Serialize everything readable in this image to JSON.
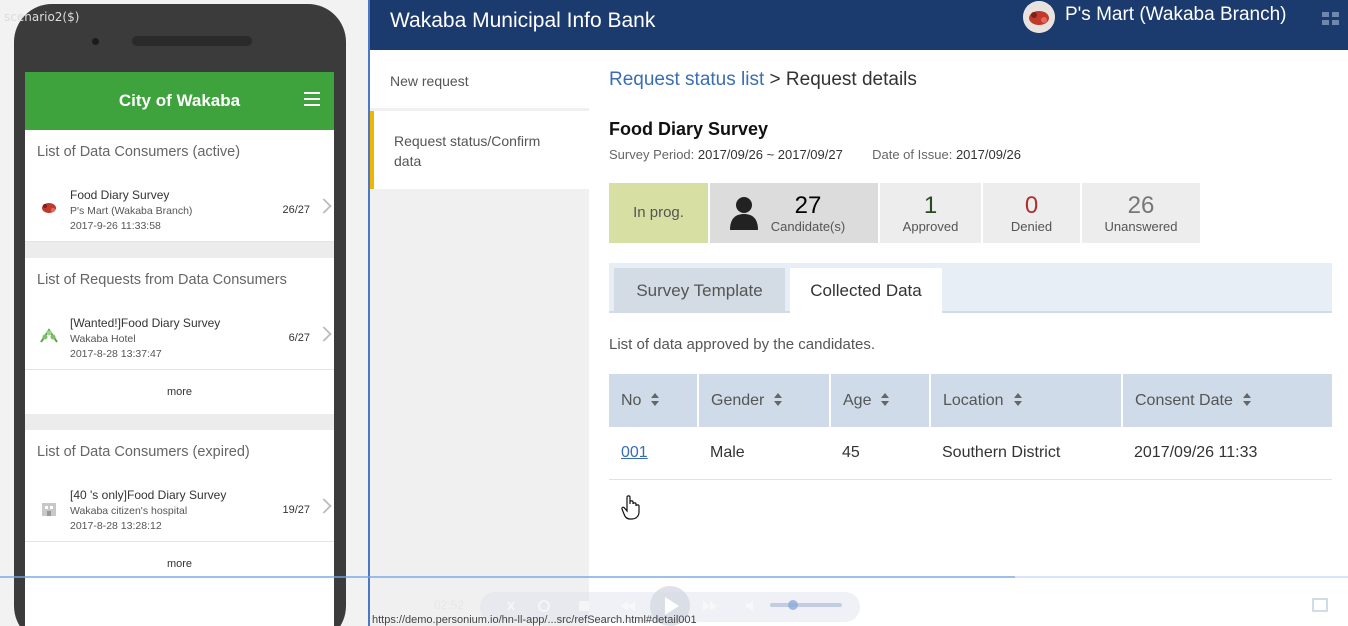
{
  "video": {
    "scenario_label": "scenario2($)",
    "time": "02:52",
    "status_url": "https://demo.personium.io/hn-ll-app/...src/refSearch.html#detail001"
  },
  "phone": {
    "app_title": "City of Wakaba",
    "section_active": {
      "title": "List of Data Consumers (active)",
      "items": [
        {
          "title": "Food Diary Survey",
          "org": "P's Mart (Wakaba Branch)",
          "date": "2017-9-26 11:33:58",
          "count": "26/27"
        }
      ]
    },
    "section_requests": {
      "title": "List of Requests from Data Consumers",
      "items": [
        {
          "title": "[Wanted!]Food Diary Survey",
          "org": "Wakaba Hotel",
          "date": "2017-8-28 13:37:47",
          "count": "6/27"
        }
      ],
      "more_label": "more"
    },
    "section_expired": {
      "title": "List of Data Consumers (expired)",
      "items": [
        {
          "title": "[40 's only]Food Diary Survey",
          "org": "Wakaba citizen's hospital",
          "date": "2017-8-28 13:28:12",
          "count": "19/27"
        }
      ],
      "more_label": "more"
    }
  },
  "app": {
    "brand": "Wakaba Municipal Info Bank",
    "user_name": "P's Mart (Wakaba Branch)",
    "nav": {
      "new_request": "New request",
      "request_status": "Request status/Confirm data"
    },
    "breadcrumb": {
      "link": "Request status list",
      "separator": ">",
      "current": "Request details"
    },
    "survey": {
      "title": "Food Diary Survey",
      "period_label": "Survey Period:",
      "period_value": "2017/09/26 ~ 2017/09/27",
      "issue_label": "Date of Issue:",
      "issue_value": "2017/09/26"
    },
    "stats": {
      "status": "In prog.",
      "candidates": {
        "value": "27",
        "label": "Candidate(s)"
      },
      "approved": {
        "value": "1",
        "label": "Approved"
      },
      "denied": {
        "value": "0",
        "label": "Denied"
      },
      "unanswered": {
        "value": "26",
        "label": "Unanswered"
      }
    },
    "tabs": {
      "template": "Survey Template",
      "collected": "Collected Data"
    },
    "caption": "List of data approved by the candidates.",
    "table": {
      "headers": [
        "No",
        "Gender",
        "Age",
        "Location",
        "Consent Date"
      ],
      "rows": [
        {
          "no": "001",
          "gender": "Male",
          "age": "45",
          "location": "Southern District",
          "consent": "2017/09/26 11:33"
        }
      ]
    }
  },
  "colors": {
    "phone_header": "#3ea33c",
    "topbar": "#1b3a6e",
    "link": "#3a6db5",
    "status_badge": "#d7e0a2",
    "nav_active_marker": "#f0b400",
    "denied": "#b03030"
  }
}
